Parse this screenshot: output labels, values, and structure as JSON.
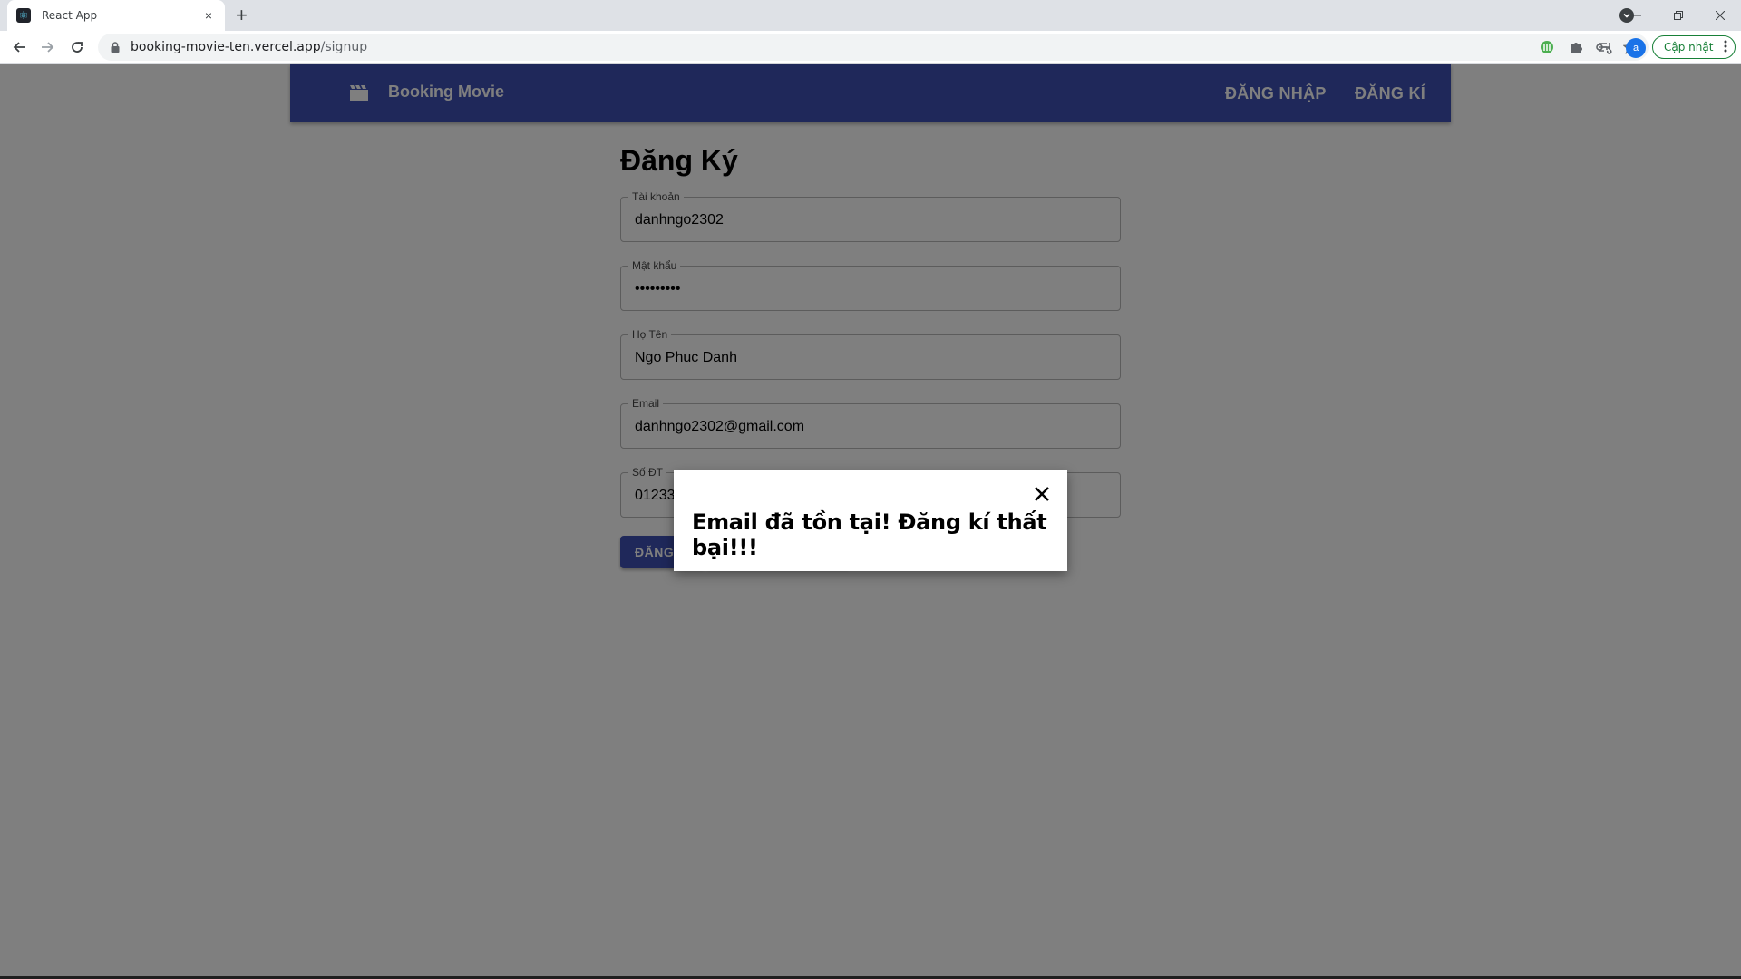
{
  "browser": {
    "tab_title": "React App",
    "tab_close": "×",
    "new_tab": "+",
    "url_host": "booking-movie-ten.vercel.app",
    "url_path": "/signup",
    "avatar_letter": "a",
    "update_label": "Cập nhật"
  },
  "app": {
    "brand": "Booking Movie",
    "nav_login": "ĐĂNG NHẬP",
    "nav_signup": "ĐĂNG KÍ",
    "bar_color": "#3f51b5"
  },
  "form": {
    "title": "Đăng Ký",
    "fields": [
      {
        "label": "Tài khoản",
        "value": "danhngo2302",
        "type": "text"
      },
      {
        "label": "Mật khẩu",
        "value": "•••••••••",
        "type": "text"
      },
      {
        "label": "Họ Tên",
        "value": "Ngo Phuc Danh",
        "type": "text"
      },
      {
        "label": "Email",
        "value": "danhngo2302@gmail.com",
        "type": "text"
      },
      {
        "label": "Số ĐT",
        "value": "01233",
        "type": "text"
      }
    ],
    "submit_label": "ĐĂNG",
    "secondary_label": ""
  },
  "modal": {
    "message": "Email đã tồn tại! Đăng kí thất bại!!!"
  }
}
